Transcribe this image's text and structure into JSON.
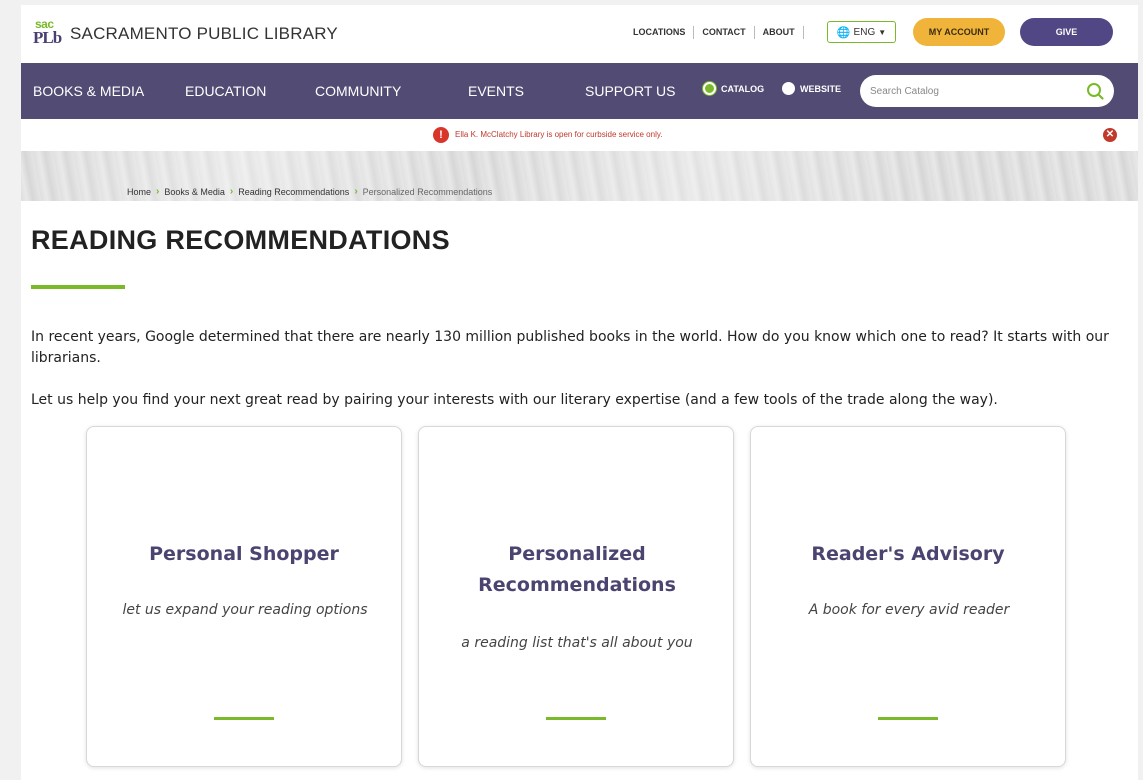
{
  "header": {
    "logo_sac": "sac",
    "logo_plb": "PLb",
    "logo_text": "SACRAMENTO PUBLIC LIBRARY",
    "links": [
      "LOCATIONS",
      "CONTACT",
      "ABOUT"
    ],
    "lang": "ENG",
    "my_account": "MY ACCOUNT",
    "give": "GIVE"
  },
  "nav": {
    "items": [
      "BOOKS & MEDIA",
      "EDUCATION",
      "COMMUNITY",
      "EVENTS",
      "SUPPORT US"
    ],
    "radio_catalog": "CATALOG",
    "radio_website": "WEBSITE",
    "search_placeholder": "Search Catalog"
  },
  "alert": {
    "message": "Ella K. McClatchy Library is open for curbside service only."
  },
  "breadcrumb": [
    "Home",
    "Books & Media",
    "Reading Recommendations",
    "Personalized Recommendations"
  ],
  "main": {
    "title": "READING RECOMMENDATIONS",
    "para1": "In recent years, Google determined that there are nearly 130 million published books in the world. How do you know which one to read? It starts with our librarians.",
    "para2": "Let us help you find your next great read by pairing your interests with our literary expertise (and a few tools of the trade along the way).",
    "cards": [
      {
        "title": "Personal Shopper",
        "subtitle": "let us expand your reading options"
      },
      {
        "title": "Personalized Recommendations",
        "subtitle": "a reading list that's all about you"
      },
      {
        "title": "Reader's Advisory",
        "subtitle": "A book for every avid reader"
      }
    ]
  },
  "colors": {
    "purple": "#524b74",
    "green": "#7ab929",
    "gold": "#f0b43a",
    "alert_red": "#c0392b"
  },
  "icons": [
    "globe-icon",
    "caret-down-icon",
    "search-icon",
    "alert-icon",
    "close-icon",
    "chevron-right-icon"
  ]
}
